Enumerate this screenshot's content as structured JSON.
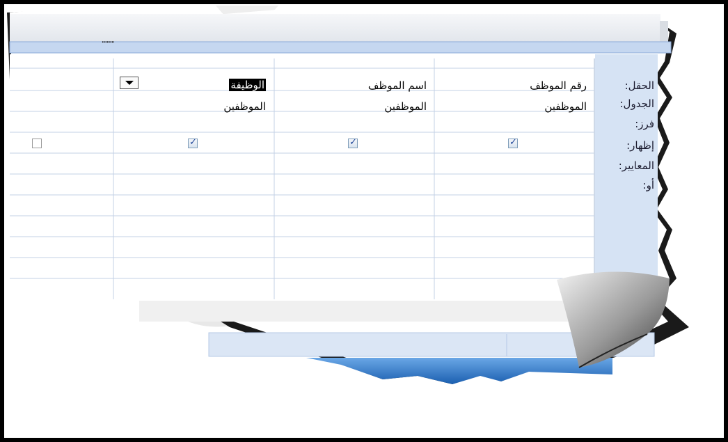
{
  "row_labels": {
    "field": "الحقل:",
    "table": "الجدول:",
    "sort": "فرز:",
    "show": "إظهار:",
    "criteria": "المعايير:",
    "or": "أو:"
  },
  "columns": [
    {
      "field": "رقم الموظف",
      "table": "الموظفين",
      "show": true
    },
    {
      "field": "اسم الموظف",
      "table": "الموظفين",
      "show": true
    },
    {
      "field": "الوظيفة",
      "table": "الموظفين",
      "show": true,
      "selected": true
    },
    {
      "field": "",
      "table": "",
      "show": false
    }
  ],
  "splitter_marks": "''''''''''",
  "colors": {
    "header_bar": "#e9ecf1",
    "splitter": "#8aa9d9",
    "label_panel": "#d6e3f4",
    "grid_line": "#c3d1e6",
    "bottom_bar": "#dbe6f5",
    "taskbar_blue": "#2f7bd1"
  },
  "icons": {
    "dropdown": "chevron-down-icon",
    "check": "check-icon",
    "page_curl": "page-curl"
  }
}
